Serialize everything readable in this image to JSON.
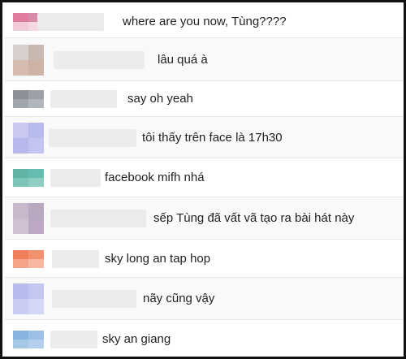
{
  "chat": {
    "messages": [
      {
        "text": "where are you now, Tùng????",
        "avatar_colors": [
          "#e07ca0",
          "#d98aa8",
          "#f2ccd9",
          "#f4d8e2"
        ],
        "name_blur": "#ebebeb"
      },
      {
        "text": "lâu quá à",
        "avatar_colors": [
          "#d8d0cc",
          "#c8b8b0",
          "#d6bcb0",
          "#cdb2a6"
        ],
        "name_blur": "#ececec"
      },
      {
        "text": "say oh yeah",
        "avatar_colors": [
          "#8a9096",
          "#9aa0a6",
          "#a0a6ac",
          "#b0b6bc"
        ],
        "name_blur": "#ececec"
      },
      {
        "text": "tôi thấy trên face là 17h30",
        "avatar_colors": [
          "#c8c8f0",
          "#b8bcec",
          "#b8b8ec",
          "#c4c4f2"
        ],
        "name_blur": "#ececec"
      },
      {
        "text": "facebook mifh nhá",
        "avatar_colors": [
          "#5fb4a6",
          "#66bcae",
          "#7cc4b8",
          "#8fcec2"
        ],
        "name_blur": "#ececec"
      },
      {
        "text": "sếp Tùng đã vất vã tạo ra bài hát này",
        "avatar_colors": [
          "#c8b8cc",
          "#b8a8c0",
          "#d0c0d4",
          "#bca8c4"
        ],
        "name_blur": "#ebebeb"
      },
      {
        "text": "sky long an tap hop",
        "avatar_colors": [
          "#f0805c",
          "#f29070",
          "#f4a488",
          "#f6b8a0"
        ],
        "name_blur": "#ececec"
      },
      {
        "text": "nãy cũng vậy",
        "avatar_colors": [
          "#b8bcec",
          "#c4c8f0",
          "#c8ccf2",
          "#d4d6f6"
        ],
        "name_blur": "#ececec"
      },
      {
        "text": "sky an giang",
        "avatar_colors": [
          "#8ab4e0",
          "#9cc0e6",
          "#a8c8ea",
          "#b4d0ee"
        ],
        "name_blur": "#ececec"
      }
    ]
  }
}
